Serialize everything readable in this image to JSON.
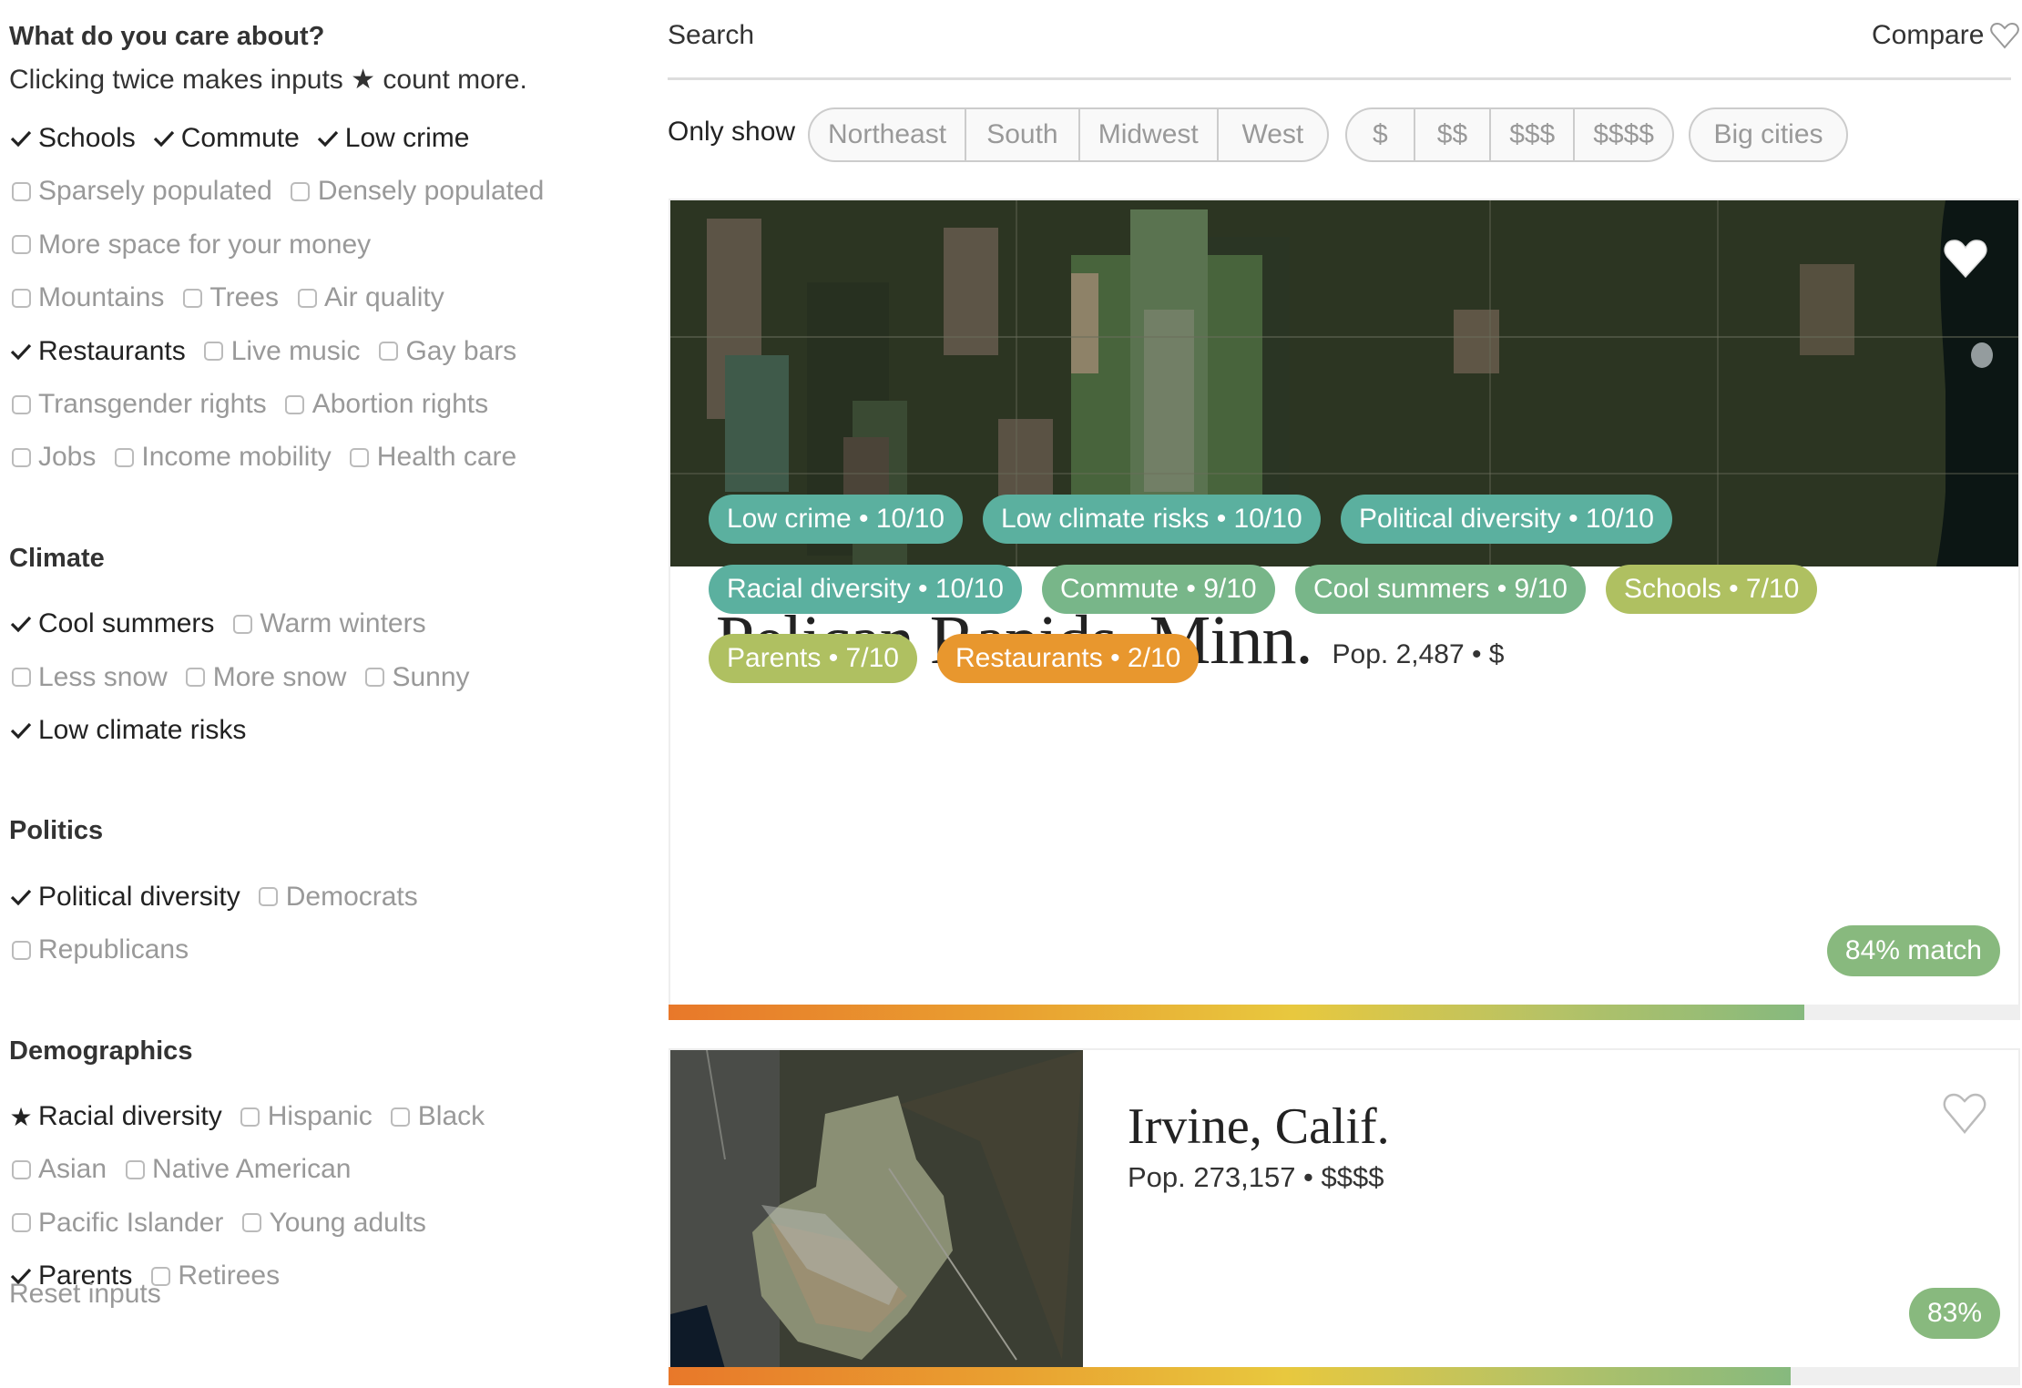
{
  "sidebar": {
    "heading": "What do you care about?",
    "subtitle_before": "Clicking twice makes inputs",
    "subtitle_after": "count more.",
    "reset_label": "Reset inputs",
    "groups": [
      {
        "heading": "",
        "rows": [
          [
            {
              "label": "Schools",
              "state": "checked"
            },
            {
              "label": "Commute",
              "state": "checked"
            },
            {
              "label": "Low crime",
              "state": "checked"
            }
          ],
          [
            {
              "label": "Sparsely populated",
              "state": "unchecked"
            },
            {
              "label": "Densely populated",
              "state": "unchecked"
            }
          ],
          [
            {
              "label": "More space for your money",
              "state": "unchecked"
            }
          ],
          [
            {
              "label": "Mountains",
              "state": "unchecked"
            },
            {
              "label": "Trees",
              "state": "unchecked"
            },
            {
              "label": "Air quality",
              "state": "unchecked"
            }
          ],
          [
            {
              "label": "Restaurants",
              "state": "checked"
            },
            {
              "label": "Live music",
              "state": "unchecked"
            },
            {
              "label": "Gay bars",
              "state": "unchecked"
            }
          ],
          [
            {
              "label": "Transgender rights",
              "state": "unchecked"
            },
            {
              "label": "Abortion rights",
              "state": "unchecked"
            }
          ],
          [
            {
              "label": "Jobs",
              "state": "unchecked"
            },
            {
              "label": "Income mobility",
              "state": "unchecked"
            },
            {
              "label": "Health care",
              "state": "unchecked"
            }
          ]
        ]
      },
      {
        "heading": "Climate",
        "rows": [
          [
            {
              "label": "Cool summers",
              "state": "checked"
            },
            {
              "label": "Warm winters",
              "state": "unchecked"
            }
          ],
          [
            {
              "label": "Less snow",
              "state": "unchecked"
            },
            {
              "label": "More snow",
              "state": "unchecked"
            },
            {
              "label": "Sunny",
              "state": "unchecked"
            }
          ],
          [
            {
              "label": "Low climate risks",
              "state": "checked"
            }
          ]
        ]
      },
      {
        "heading": "Politics",
        "rows": [
          [
            {
              "label": "Political diversity",
              "state": "checked"
            },
            {
              "label": "Democrats",
              "state": "unchecked"
            }
          ],
          [
            {
              "label": "Republicans",
              "state": "unchecked"
            }
          ]
        ]
      },
      {
        "heading": "Demographics",
        "rows": [
          [
            {
              "label": "Racial diversity",
              "state": "starred"
            },
            {
              "label": "Hispanic",
              "state": "unchecked"
            },
            {
              "label": "Black",
              "state": "unchecked"
            }
          ],
          [
            {
              "label": "Asian",
              "state": "unchecked"
            },
            {
              "label": "Native American",
              "state": "unchecked"
            }
          ],
          [
            {
              "label": "Pacific Islander",
              "state": "unchecked"
            },
            {
              "label": "Young adults",
              "state": "unchecked"
            }
          ],
          [
            {
              "label": "Parents",
              "state": "checked"
            },
            {
              "label": "Retirees",
              "state": "unchecked"
            }
          ]
        ]
      }
    ]
  },
  "header": {
    "search_label": "Search",
    "compare_label": "Compare",
    "compare_icon": "heart-outline-icon"
  },
  "filters": {
    "label": "Only show",
    "regions": [
      "Northeast",
      "South",
      "Midwest",
      "West"
    ],
    "prices": [
      "$",
      "$$",
      "$$$",
      "$$$$"
    ],
    "size": [
      "Big cities"
    ]
  },
  "colors": {
    "tag_teal": "#5bb09f",
    "tag_green": "#78b689",
    "tag_olive": "#afc061",
    "tag_orange": "#e8972e",
    "match_green": "#88b97e",
    "bar_track": "#efefef"
  },
  "results": [
    {
      "name": "Pelican Rapids, Minn.",
      "meta": "Pop. 2,487 • $",
      "favorited": true,
      "tags": [
        {
          "label": "Low crime • 10/10",
          "color": "#5bb09f"
        },
        {
          "label": "Low climate risks • 10/10",
          "color": "#5bb09f"
        },
        {
          "label": "Political diversity • 10/10",
          "color": "#5bb09f"
        },
        {
          "label": "Racial diversity • 10/10",
          "color": "#5bb09f"
        },
        {
          "label": "Commute • 9/10",
          "color": "#78b689"
        },
        {
          "label": "Cool summers • 9/10",
          "color": "#78b689"
        },
        {
          "label": "Schools • 7/10",
          "color": "#afc061"
        },
        {
          "label": "Parents • 7/10",
          "color": "#afc061"
        },
        {
          "label": "Restaurants • 2/10",
          "color": "#e8972e"
        }
      ],
      "match_label": "84% match",
      "match_percent": 84
    },
    {
      "name": "Irvine, Calif.",
      "meta": "Pop. 273,157 • $$$$",
      "favorited": false,
      "tags": [],
      "match_label": "83%",
      "match_percent": 83
    }
  ]
}
